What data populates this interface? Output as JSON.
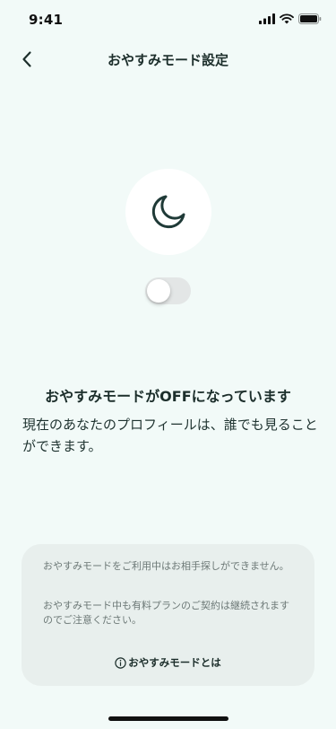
{
  "status_bar": {
    "time": "9:41",
    "signal_icon": "cellular-signal-icon",
    "wifi_icon": "wifi-icon",
    "battery_icon": "battery-icon"
  },
  "nav": {
    "back_icon": "chevron-left-icon",
    "title": "おやすみモード設定"
  },
  "hero": {
    "icon": "moon-icon",
    "toggle_state": "off"
  },
  "main": {
    "headline": "おやすみモードがOFFになっています",
    "description": "現在のあなたのプロフィールは、誰でも見ることができます。"
  },
  "info_card": {
    "note_1": "おやすみモードをご利用中はお相手探しができません。",
    "note_2": "おやすみモード中も有料プランのご契約は継続されますのでご注意ください。",
    "link_icon": "info-circle-icon",
    "link_label": "おやすみモードとは"
  },
  "colors": {
    "background": "#f2faf8",
    "card": "#e8efed",
    "text_primary": "#1c2e2b",
    "text_muted": "#6c7876",
    "toggle_off": "#e3e6e6"
  }
}
